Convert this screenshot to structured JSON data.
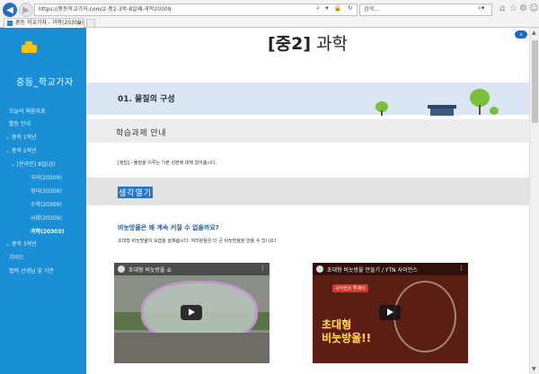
{
  "browser": {
    "url": "https://중등학교가자.com/2-중2-3학-8일째-과학20309",
    "search_placeholder": "검색...",
    "tab_title": "중등 학교가자 - 과학(20309)",
    "tab_close": "×"
  },
  "sidebar": {
    "site_title": "중등_학교가자",
    "items": [
      {
        "label": "오늘의 배움자료"
      },
      {
        "label": "활동 안내"
      },
      {
        "label": "⌄ 중학 1학년"
      },
      {
        "label": "⌄ 중학 2학년"
      },
      {
        "label": "⌄ [온라인] 8일(금)"
      },
      {
        "label": "국어(20309)"
      },
      {
        "label": "영어(20309)"
      },
      {
        "label": "수학(20309)"
      },
      {
        "label": "사회(20309)"
      },
      {
        "label": "과학(20309)"
      },
      {
        "label": "⌄ 중학 3학년"
      },
      {
        "label": "가이드"
      },
      {
        "label": "협력 선생님 및 기관"
      }
    ],
    "active_index": 9
  },
  "page": {
    "title_bracket": "[중2]",
    "title_rest": " 과학",
    "section_title": "01. 물질의 구성",
    "subsection_title": "학습과제 안내",
    "task_desc": "[정답] · 물질을 이루는 기본 성분에 대해 알아봅시다.",
    "think_title": "생각열기",
    "question": "비눗방울은 왜 계속 커질 수 없을까요?",
    "question_desc": "초대형 비눗방울의 모습을 살펴봅시다. 여러분들은 더 큰 비눗방울을 만들 수 있나요?"
  },
  "videos": [
    {
      "title": "초대형 비눗방울 쇼"
    },
    {
      "title": "초대형 비눗방울 만들기 / YTN 사이언스",
      "badge": "사이언스 투데이",
      "overlay_line1": "초대형",
      "overlay_line2": "비눗방울!!"
    }
  ],
  "icons": {
    "back": "arrow-left-icon",
    "forward": "arrow-right-icon",
    "search": "search-icon",
    "home": "home-icon",
    "star": "star-icon",
    "settings": "gear-icon",
    "smiley": "smiley-icon",
    "play": "play-icon",
    "menu": "more-vertical-icon"
  },
  "colors": {
    "sidebar": "#1a8fd6",
    "accent": "#2876c9",
    "banner": "#dbe6f4"
  }
}
